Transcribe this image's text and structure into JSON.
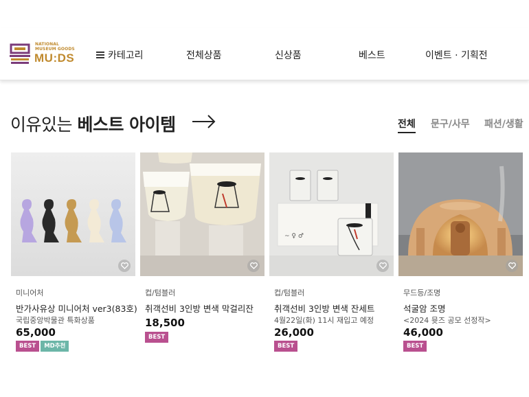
{
  "brand": {
    "line1": "NATIONAL",
    "line2": "MUSEUM GOODS",
    "name": "MU:DS"
  },
  "nav": {
    "category": "카테고리",
    "all": "전체상품",
    "new": "신상품",
    "best": "베스트",
    "events": "이벤트 · 기획전"
  },
  "section": {
    "title_prefix": "이유있는 ",
    "title_bold": "베스트 아이템"
  },
  "filters": [
    "전체",
    "문구/사무",
    "패션/생활"
  ],
  "products": [
    {
      "category": "미니어처",
      "name": "반가사유상 미니어처 ver3(83호)",
      "subtitle": "국립중앙박물관 특화상품",
      "price": "65,000",
      "badges": [
        "BEST",
        "MD추천"
      ]
    },
    {
      "category": "컵/텀블러",
      "name": "취객선비 3인방 변색 막걸리잔",
      "subtitle": "",
      "price": "18,500",
      "badges": [
        "BEST"
      ]
    },
    {
      "category": "컵/텀블러",
      "name": "취객선비 3인방 변색 잔세트",
      "subtitle": "4월22일(화) 11시 재입고 예정",
      "price": "26,000",
      "badges": [
        "BEST"
      ]
    },
    {
      "category": "무드등/조명",
      "name": "석굴암 조명",
      "subtitle": "<2024 뮷즈 공모 선정작>",
      "price": "46,000",
      "badges": [
        "BEST"
      ]
    }
  ]
}
